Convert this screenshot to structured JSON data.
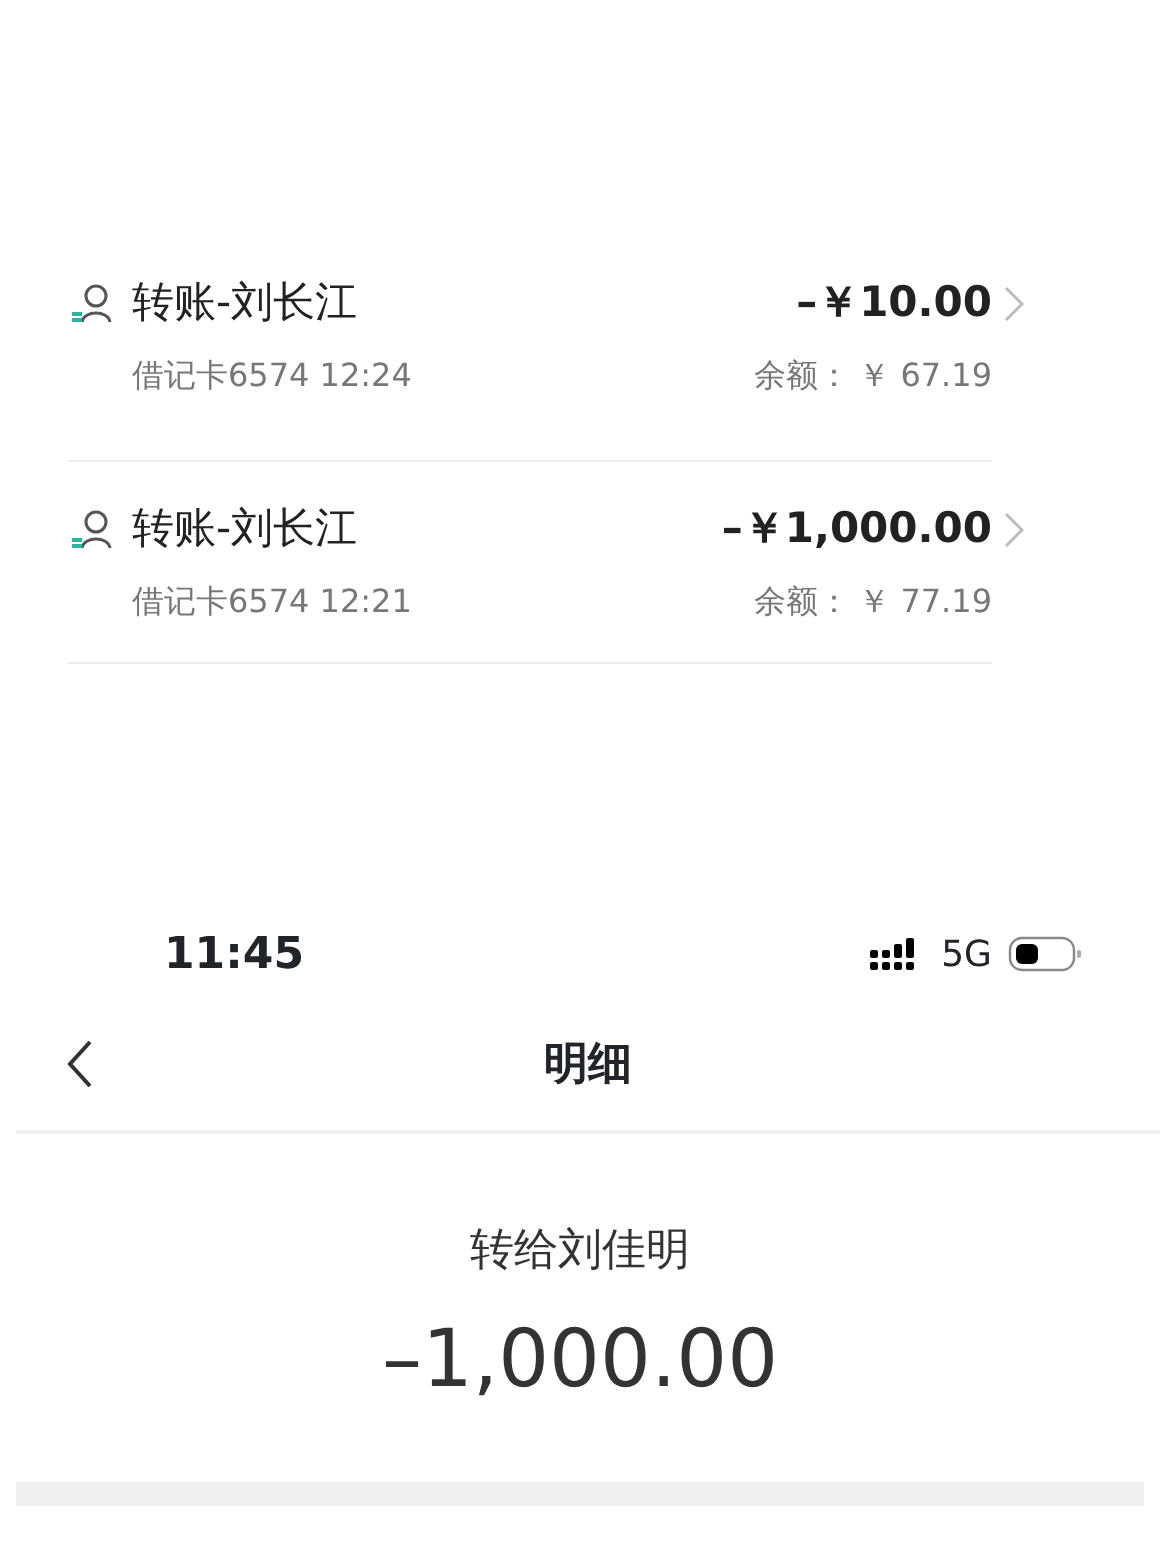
{
  "transactions": [
    {
      "title": "转账-刘长江",
      "amount": "–￥10.00",
      "meta": "借记卡6574 12:24",
      "balance_label": "余额：",
      "balance": "￥ 67.19"
    },
    {
      "title": "转账-刘长江",
      "amount": "–￥1,000.00",
      "meta": "借记卡6574 12:21",
      "balance_label": "余额：",
      "balance": "￥ 77.19"
    }
  ],
  "status_bar": {
    "time": "11:45",
    "network": "5G"
  },
  "nav": {
    "title": "明细"
  },
  "detail": {
    "payee": "转给刘佳明",
    "amount": "–1,000.00"
  }
}
